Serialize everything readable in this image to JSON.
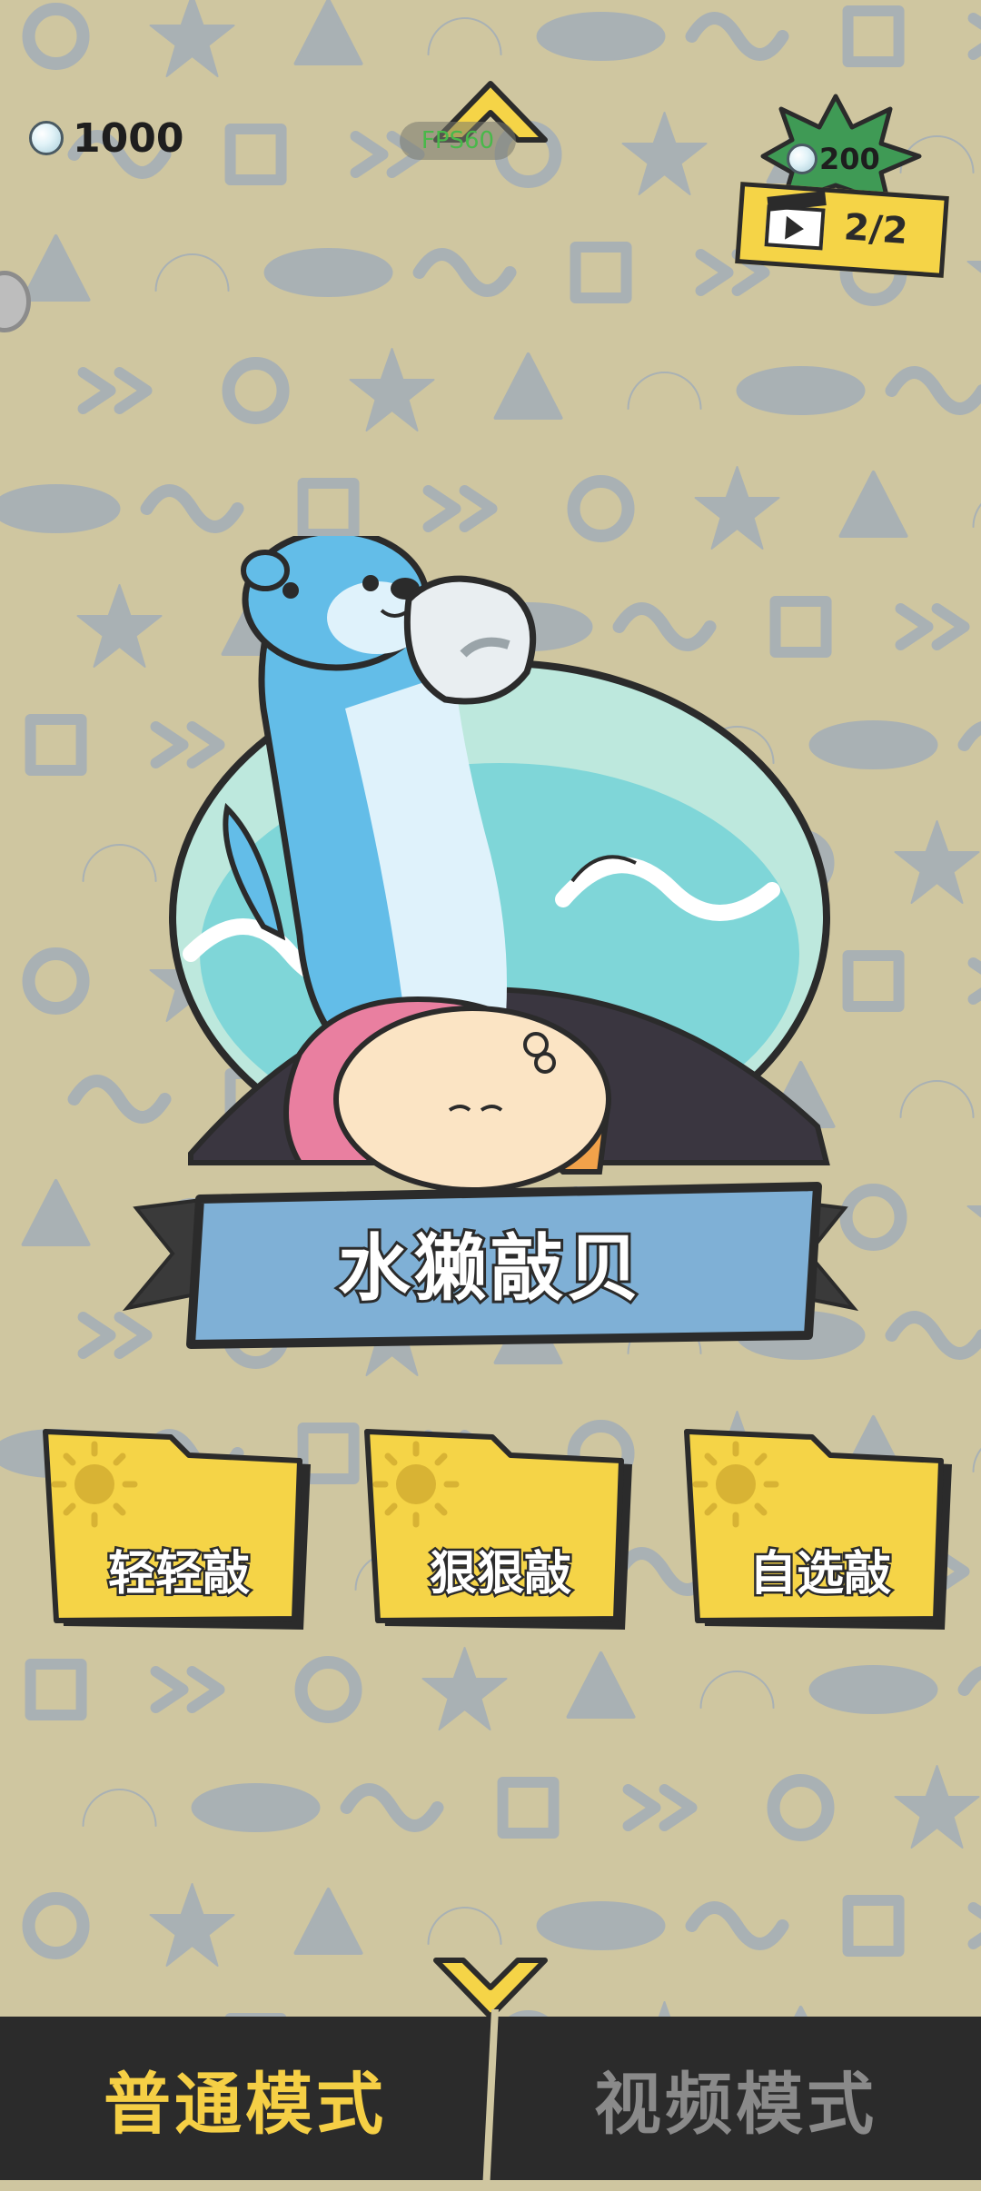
{
  "currency": {
    "icon": "pearl-icon",
    "amount": "1000"
  },
  "fps_label": "FPS60",
  "reward": {
    "icon": "pearl-icon",
    "amount": "200",
    "video_icon": "video-clapper-icon",
    "count": "2/2"
  },
  "title": "水獭敲贝",
  "modes": [
    {
      "label": "轻轻敲",
      "icon": "sun-icon"
    },
    {
      "label": "狠狠敲",
      "icon": "sun-icon"
    },
    {
      "label": "自选敲",
      "icon": "sun-icon"
    }
  ],
  "bottom_tabs": [
    {
      "label": "普通模式",
      "active": true
    },
    {
      "label": "视频模式",
      "active": false
    }
  ],
  "colors": {
    "background": "#cfc6a0",
    "pattern": "#a9b1b4",
    "folder_yellow": "#f5d447",
    "banner_blue": "#7fb0d6",
    "nav_dark": "#2b2b2b",
    "active_tab": "#f5cf45",
    "inactive_tab": "#8a8a8a"
  }
}
